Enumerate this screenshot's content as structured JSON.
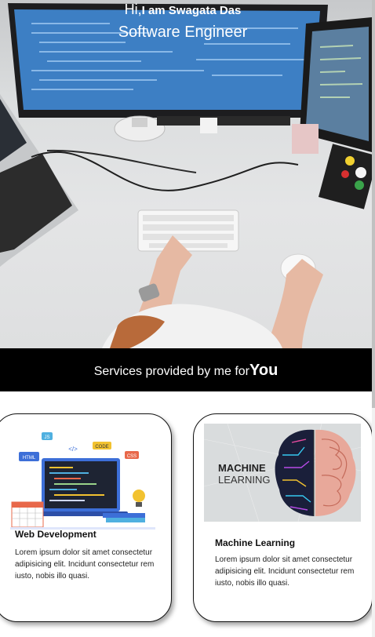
{
  "hero": {
    "greeting_prefix": "Hi,",
    "greeting_name": "I am Swagata Das",
    "role": "Software Engineer"
  },
  "services": {
    "heading": "Services provided by me for",
    "emphasis": "You"
  },
  "cards": [
    {
      "title": "Web Development",
      "body": "Lorem ipsum dolor sit amet consectetur adipisicing elit. Incidunt consectetur rem iusto, nobis illo quasi.",
      "image_tags": [
        "JS",
        "</>",
        "CODE",
        "HTML",
        "CSS"
      ]
    },
    {
      "title": "Machine Learning",
      "body": "Lorem ipsum dolor sit amet consectetur adipisicing elit. Incidunt consectetur rem iusto, nobis illo quasi.",
      "image_line1": "MACHINE",
      "image_line2": "LEARNING"
    }
  ],
  "colors": {
    "bar_bg": "#000000",
    "screen_blue": "#3d7fc4",
    "tag_js": "#4fb0e0",
    "tag_code": "#f2c230",
    "tag_html": "#3d6fd8",
    "tag_css": "#e8684a"
  }
}
